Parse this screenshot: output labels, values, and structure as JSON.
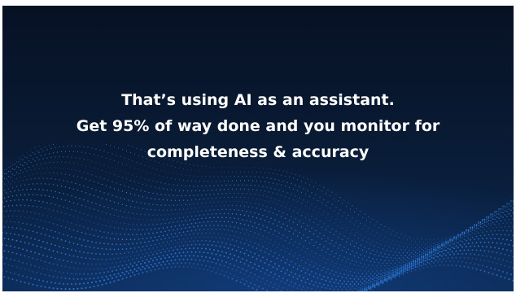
{
  "slide": {
    "lines": [
      "That’s using AI as an assistant.",
      "Get 95% of way done and you monitor for",
      "completeness & accuracy"
    ]
  },
  "colors": {
    "background_top": "#071124",
    "background_bottom": "#0b2850",
    "text": "#ffffff",
    "wave_dots": "#2f7fe0"
  }
}
